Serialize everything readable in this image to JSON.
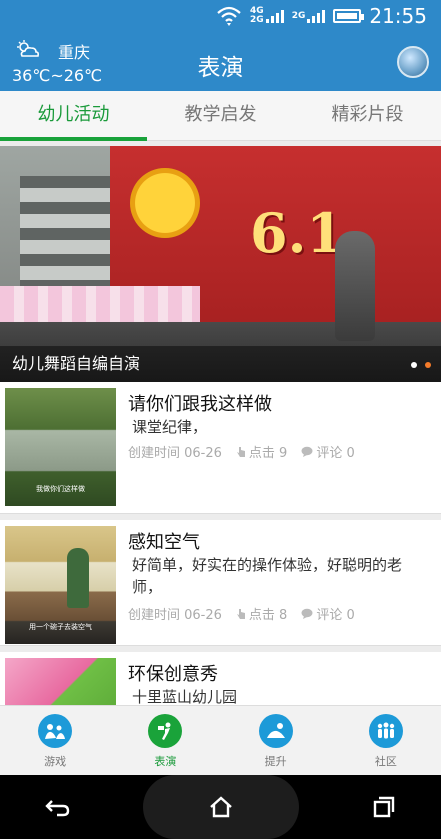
{
  "status_bar": {
    "time": "21:55",
    "net_top": "4G",
    "net_bottom": "2G",
    "net_second": "2G"
  },
  "header": {
    "city": "重庆",
    "temperature": "36℃~26℃",
    "title": "表演"
  },
  "tabs": [
    {
      "label": "幼儿活动",
      "active": true
    },
    {
      "label": "教学启发",
      "active": false
    },
    {
      "label": "精彩片段",
      "active": false
    }
  ],
  "banner": {
    "caption": "幼儿舞蹈自编自演",
    "page_count": 2,
    "active_index": 1
  },
  "list": [
    {
      "title": "请你们跟我这样做",
      "desc": "课堂纪律，",
      "created": "创建时间 06-26",
      "clicks": "点击 9",
      "comments": "评论 0",
      "thumb_caption": "我做你们这样做"
    },
    {
      "title": "感知空气",
      "desc": "好简单，好实在的操作体验，好聪明的老师，",
      "created": "创建时间 06-26",
      "clicks": "点击 8",
      "comments": "评论 0",
      "thumb_caption": "用一个碗子去装空气"
    },
    {
      "title": "环保创意秀",
      "desc": "十里蓝山幼儿园",
      "created": "",
      "clicks": "",
      "comments": ""
    }
  ],
  "bottom_nav": [
    {
      "label": "游戏",
      "icon": "game-icon",
      "active": false
    },
    {
      "label": "表演",
      "icon": "performance-icon",
      "active": true
    },
    {
      "label": "提升",
      "icon": "improve-icon",
      "active": false
    },
    {
      "label": "社区",
      "icon": "community-icon",
      "active": false
    }
  ],
  "colors": {
    "header_blue": "#2e89c9",
    "active_green": "#1a9a3a",
    "nav_blue": "#1d9ad8",
    "dot_active": "#f47b2a"
  }
}
